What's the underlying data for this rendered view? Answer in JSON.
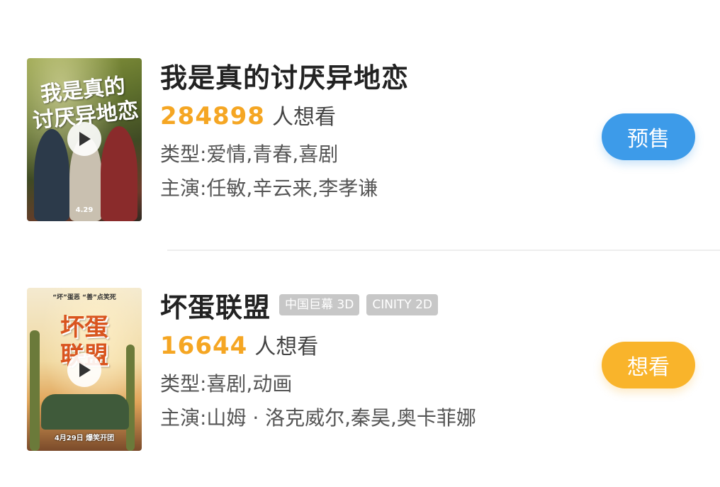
{
  "movies": [
    {
      "title": "我是真的讨厌异地恋",
      "want_count": "284898",
      "want_label": "人想看",
      "genre": "类型:爱情,青春,喜剧",
      "cast": "主演:任敏,辛云来,李孝谦",
      "button_label": "预售",
      "button_color": "#3d9be9",
      "badges": [],
      "poster": {
        "title_line1": "我是真的",
        "title_line2": "讨厌异地恋",
        "date": "4.29"
      }
    },
    {
      "title": "坏蛋联盟",
      "want_count": "16644",
      "want_label": "人想看",
      "genre": "类型:喜剧,动画",
      "cast": "主演:山姆 · 洛克威尔,秦昊,奥卡菲娜",
      "button_label": "想看",
      "button_color": "#f9b42b",
      "badges": [
        "中国巨幕 3D",
        "CINITY 2D"
      ],
      "poster": {
        "tagline": "“坏”蛋恶 “善”点笑死",
        "title_line1": "坏蛋",
        "title_line2": "联盟",
        "date": "4月29日 爆笑开团"
      }
    }
  ],
  "colors": {
    "want_count": "#f5a623",
    "badge_bg": "#c7c7c7"
  }
}
